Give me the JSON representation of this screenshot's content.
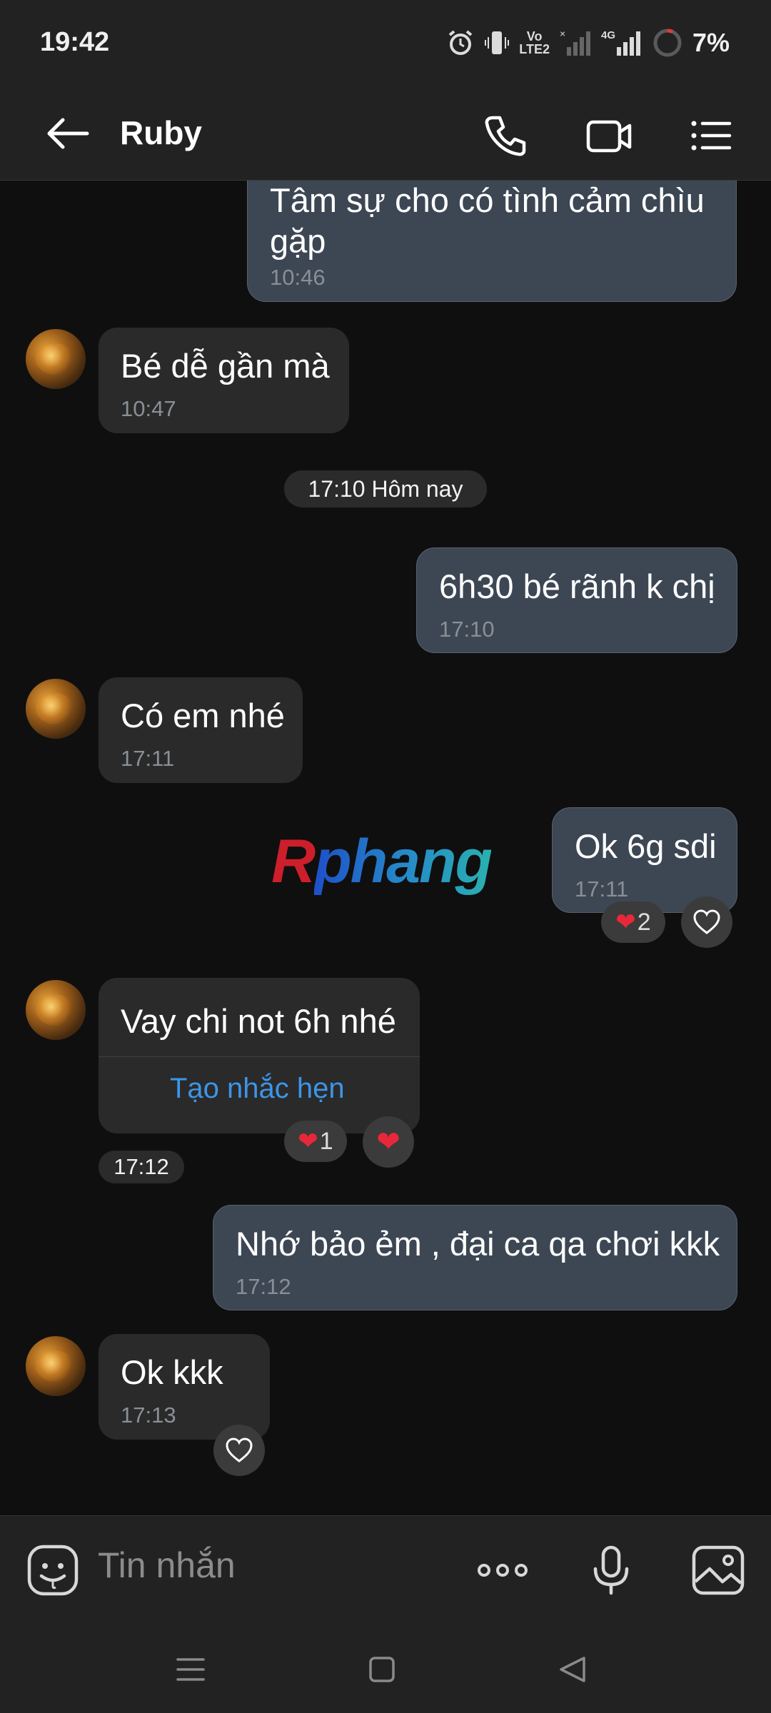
{
  "status_bar": {
    "time": "19:42",
    "network_volte": "Vo\nLTE2",
    "network_4g": "4G",
    "battery": "7%",
    "icons": [
      "alarm-icon",
      "vibrate-icon",
      "volte-icon",
      "signal-icon",
      "4g-signal-icon",
      "battery-icon"
    ]
  },
  "header": {
    "title": "Ruby",
    "icons": [
      "back-arrow-icon",
      "phone-icon",
      "video-call-icon",
      "menu-icon"
    ]
  },
  "messages": [
    {
      "side": "out",
      "text": "Tâm sự cho có tình cảm chìu gặp",
      "time": "10:46"
    },
    {
      "side": "in",
      "text": "Bé dễ gần mà",
      "time": "10:47"
    },
    {
      "side": "out",
      "text": "6h30 bé rãnh k chị",
      "time": "17:10"
    },
    {
      "side": "in",
      "text": "Có em nhé",
      "time": "17:11"
    },
    {
      "side": "out",
      "text": "Ok 6g sdi",
      "time": "17:11",
      "reaction_count": "2"
    },
    {
      "side": "in",
      "text": "Vay chi not 6h nhé",
      "time": "17:12",
      "action": "Tạo nhắc hẹn",
      "reaction_count": "1"
    },
    {
      "side": "out",
      "text": "Nhớ bảo ẻm , đại ca qa chơi kkk",
      "time": "17:12"
    },
    {
      "side": "in",
      "text": "Ok kkk",
      "time": "17:13"
    }
  ],
  "line1": "Tâm sự cho có tình cảm chìu",
  "line2": "gặp",
  "day_separator": "17:10 Hôm nay",
  "watermark": {
    "part1": "R",
    "part2": "phang"
  },
  "composer": {
    "placeholder": "Tin nhắn",
    "icons": [
      "emoji-icon",
      "more-icon",
      "mic-icon",
      "gallery-icon"
    ]
  },
  "nav_bar": {
    "icons": [
      "recent-apps-icon",
      "home-icon",
      "back-icon"
    ]
  },
  "colors": {
    "background": "#0f0f0f",
    "bar": "#222222",
    "incoming_bubble": "#2a2a2a",
    "outgoing_bubble": "#3d4754",
    "link": "#3d95e8",
    "heart": "#e8283a"
  }
}
